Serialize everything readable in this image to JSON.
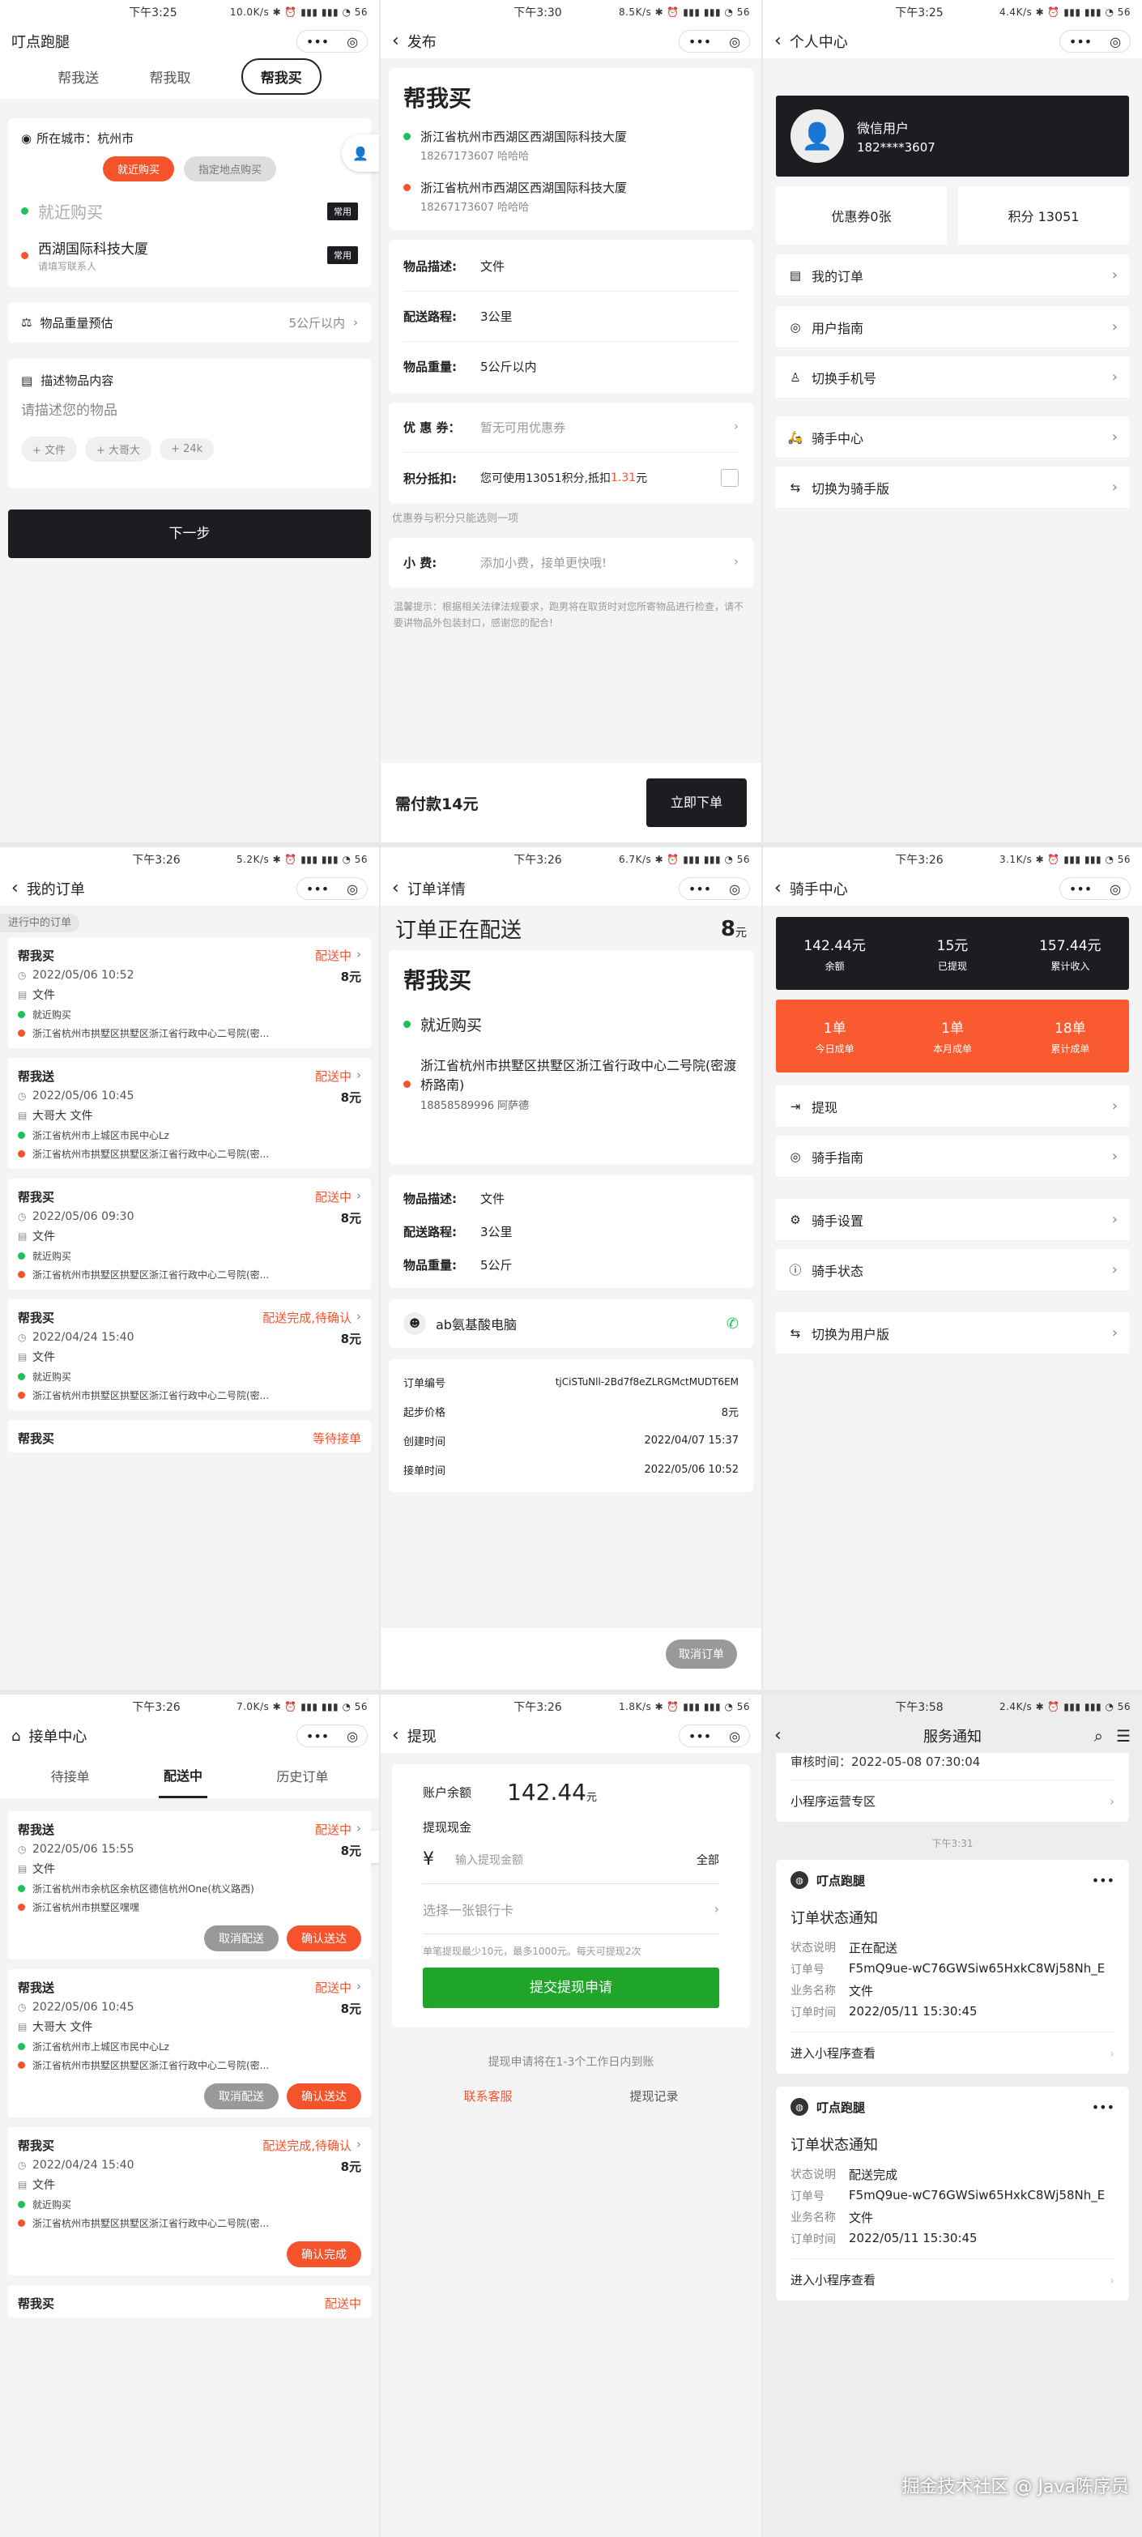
{
  "status": {
    "time1": "下午3:25",
    "net1": "10.0K/s",
    "time2": "下午3:30",
    "net2": "8.5K/s",
    "time3": "下午3:25",
    "net3": "4.4K/s",
    "time4": "下午3:26",
    "net4": "5.2K/s",
    "time5": "下午3:26",
    "net5": "6.7K/s",
    "time6": "下午3:26",
    "net6": "3.1K/s",
    "time7": "下午3:26",
    "net7": "7.0K/s",
    "time8": "下午3:26",
    "net8": "1.8K/s",
    "time9": "下午3:58",
    "net9": "2.4K/s",
    "icons": "✱ ⏰ ▮▮▮ ▮▮▮ ◔ 56"
  },
  "capsule": {
    "dots": "•••",
    "target": "◎"
  },
  "p1": {
    "title": "叮点跑腿",
    "tabs": [
      "帮我送",
      "帮我取",
      "帮我买"
    ],
    "city_label": "所在城市：杭州市",
    "btn_near": "就近购买",
    "btn_addr": "指定地点购买",
    "near_placeholder": "就近购买",
    "tag_common": "常用",
    "addr": "西湖国际科技大厦",
    "addr_sub": "请填写联系人",
    "weight_label": "物品重量预估",
    "weight_value": "5公斤以内",
    "desc_label": "描述物品内容",
    "desc_placeholder": "请描述您的物品",
    "chips": [
      "+ 文件",
      "+ 大哥大",
      "+ 24k"
    ],
    "next": "下一步"
  },
  "p2": {
    "title": "发布",
    "card_title": "帮我买",
    "addr1": "浙江省杭州市西湖区西湖国际科技大厦",
    "addr1_sub": "18267173607 哈哈哈",
    "addr2": "浙江省杭州市西湖区西湖国际科技大厦",
    "addr2_sub": "18267173607 哈哈哈",
    "desc_k": "物品描述:",
    "desc_v": "文件",
    "route_k": "配送路程:",
    "route_v": "3公里",
    "weight_k": "物品重量:",
    "weight_v": "5公斤以内",
    "coupon_k": "优 惠 券：",
    "coupon_v": "暂无可用优惠券",
    "points_k": "积分抵扣:",
    "points_v": "您可使用13051积分,抵扣",
    "points_amt": "1.31",
    "points_unit": "元",
    "note1": "优惠券与积分只能选则一项",
    "tip_k": "小 费:",
    "tip_v": "添加小费，接单更快哦!",
    "warm": "温馨提示：根据相关法律法规要求，跑男将在取货时对您所寄物品进行检查，请不要讲物品外包装封口，感谢您的配合!",
    "pay": "需付款14元",
    "submit": "立即下单"
  },
  "p3": {
    "title": "个人中心",
    "user": "微信用户",
    "phone": "182****3607",
    "coupon": "优惠券0张",
    "points": "积分 13051",
    "menu": [
      "我的订单",
      "用户指南",
      "切换手机号",
      "骑手中心",
      "切换为骑手版"
    ]
  },
  "p4": {
    "title": "我的订单",
    "section": "进行中的订单",
    "orders": [
      {
        "type": "帮我买",
        "status": "配送中",
        "date": "2022/05/06 10:52",
        "price": "8元",
        "item": "文件",
        "from": "就近购买",
        "to": "浙江省杭州市拱墅区拱墅区浙江省行政中心二号院(密..."
      },
      {
        "type": "帮我送",
        "status": "配送中",
        "date": "2022/05/06 10:45",
        "price": "8元",
        "item": "大哥大 文件",
        "from": "浙江省杭州市上城区市民中心Lz",
        "to": "浙江省杭州市拱墅区拱墅区浙江省行政中心二号院(密..."
      },
      {
        "type": "帮我买",
        "status": "配送中",
        "date": "2022/05/06 09:30",
        "price": "8元",
        "item": "文件",
        "from": "就近购买",
        "to": "浙江省杭州市拱墅区拱墅区浙江省行政中心二号院(密..."
      },
      {
        "type": "帮我买",
        "status": "配送完成,待确认",
        "date": "2022/04/24 15:40",
        "price": "8元",
        "item": "文件",
        "from": "就近购买",
        "to": "浙江省杭州市拱墅区拱墅区浙江省行政中心二号院(密..."
      }
    ],
    "last_type": "帮我买",
    "last_status": "等待接单"
  },
  "p5": {
    "title": "订单详情",
    "heading": "订单正在配送",
    "amount": "8",
    "unit": "元",
    "card_title": "帮我买",
    "from": "就近购买",
    "to": "浙江省杭州市拱墅区拱墅区浙江省行政中心二号院(密渡桥路南)",
    "to_sub": "18858589996 阿萨德",
    "desc_k": "物品描述:",
    "desc_v": "文件",
    "route_k": "配送路程:",
    "route_v": "3公里",
    "weight_k": "物品重量:",
    "weight_v": "5公斤",
    "rider": "ab氨基酸电脑",
    "order_no_k": "订单编号",
    "order_no_v": "tjCiSTuNll-2Bd7f8eZLRGMctMUDT6EM",
    "start_k": "起步价格",
    "start_v": "8元",
    "create_k": "创建时间",
    "create_v": "2022/04/07 15:37",
    "accept_k": "接单时间",
    "accept_v": "2022/05/06 10:52",
    "cancel": "取消订单"
  },
  "p6": {
    "title": "骑手中心",
    "stats1": [
      {
        "v": "142.44元",
        "l": "余额"
      },
      {
        "v": "15元",
        "l": "已提现"
      },
      {
        "v": "157.44元",
        "l": "累计收入"
      }
    ],
    "stats2": [
      {
        "v": "1单",
        "l": "今日成单"
      },
      {
        "v": "1单",
        "l": "本月成单"
      },
      {
        "v": "18单",
        "l": "累计成单"
      }
    ],
    "menu": [
      "提现",
      "骑手指南",
      "骑手设置",
      "骑手状态",
      "切换为用户版"
    ]
  },
  "p7": {
    "title": "接单中心",
    "tabs": [
      "待接单",
      "配送中",
      "历史订单"
    ],
    "orders": [
      {
        "type": "帮我送",
        "status": "配送中",
        "date": "2022/05/06 15:55",
        "price": "8元",
        "item": "文件",
        "from": "浙江省杭州市余杭区余杭区德信杭州One(杭义路西)",
        "to": "浙江省杭州市拱墅区嘿嘿",
        "b1": "取消配送",
        "b2": "确认送达"
      },
      {
        "type": "帮我送",
        "status": "配送中",
        "date": "2022/05/06 10:45",
        "price": "8元",
        "item": "大哥大 文件",
        "from": "浙江省杭州市上城区市民中心Lz",
        "to": "浙江省杭州市拱墅区拱墅区浙江省行政中心二号院(密...",
        "b1": "取消配送",
        "b2": "确认送达"
      },
      {
        "type": "帮我买",
        "status": "配送完成,待确认",
        "date": "2022/04/24 15:40",
        "price": "8元",
        "item": "文件",
        "from": "就近购买",
        "to": "浙江省杭州市拱墅区拱墅区浙江省行政中心二号院(密...",
        "b1": "",
        "b2": "确认完成"
      }
    ],
    "last_type": "帮我买",
    "last_status": "配送中"
  },
  "p8": {
    "title": "提现",
    "balance_k": "账户余额",
    "balance_v": "142.44",
    "unit": "元",
    "cash_k": "提现现金",
    "yen": "¥",
    "amount_placeholder": "输入提现金额",
    "all": "全部",
    "card_placeholder": "选择一张银行卡",
    "rule": "单笔提现最少10元，最多1000元。每天可提现2次",
    "submit": "提交提现申请",
    "arrive": "提现申请将在1-3个工作日内到账",
    "service": "联系客服",
    "record": "提现记录"
  },
  "p9": {
    "title": "服务通知",
    "top_text": "审核时间：2022-05-08 07:30:04",
    "ops": "小程序运营专区",
    "time_mid": "下午3:31",
    "msgs": [
      {
        "app": "叮点跑腿",
        "title": "订单状态通知",
        "k1": "状态说明",
        "v1": "正在配送",
        "k2": "订单号",
        "v2": "F5mQ9ue-wC76GWSiw65HxkC8Wj58Nh_E",
        "k3": "业务名称",
        "v3": "文件",
        "k4": "订单时间",
        "v4": "2022/05/11 15:30:45",
        "link": "进入小程序查看"
      },
      {
        "app": "叮点跑腿",
        "title": "订单状态通知",
        "k1": "状态说明",
        "v1": "配送完成",
        "k2": "订单号",
        "v2": "F5mQ9ue-wC76GWSiw65HxkC8Wj58Nh_E",
        "k3": "业务名称",
        "v3": "文件",
        "k4": "订单时间",
        "v4": "2022/05/11 15:30:45",
        "link": "进入小程序查看"
      }
    ],
    "watermark": "掘金技术社区 @ Java陈序员"
  }
}
